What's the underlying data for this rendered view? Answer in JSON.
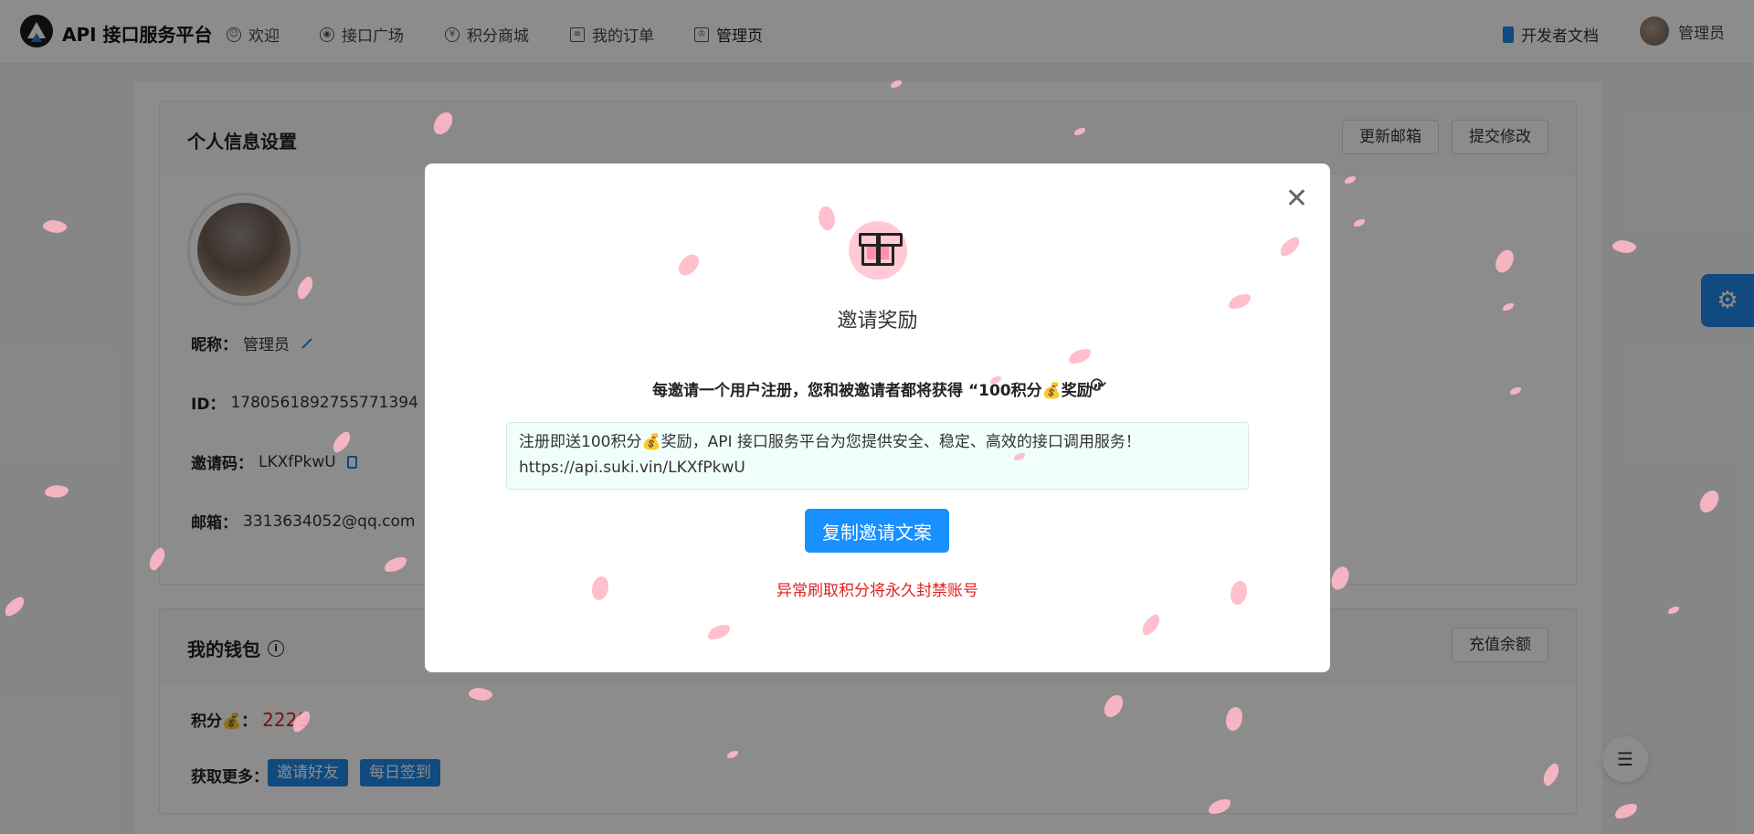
{
  "header": {
    "brand": "API 接口服务平台",
    "nav": [
      {
        "label": "欢迎",
        "icon": "smile-icon"
      },
      {
        "label": "接口广场",
        "icon": "api-icon"
      },
      {
        "label": "积分商城",
        "icon": "yen-icon"
      },
      {
        "label": "我的订单",
        "icon": "order-icon"
      },
      {
        "label": "管理页",
        "icon": "crown-icon"
      }
    ],
    "docs": "开发者文档",
    "user": "管理员"
  },
  "profile": {
    "title": "个人信息设置",
    "update_email": "更新邮箱",
    "submit": "提交修改",
    "nickname_label": "昵称：",
    "nickname": "管理员",
    "id_label": "ID：",
    "id": "1780561892755771394",
    "invite_label": "邀请码：",
    "invite_code": "LKXfPkwU",
    "email_label": "邮箱：",
    "email": "3313634052@qq.com"
  },
  "wallet": {
    "title": "我的钱包",
    "recharge": "充值余额",
    "points_label": "积分💰：",
    "points": "2229",
    "more_label": "获取更多：",
    "invite_btn": "邀请好友",
    "signin_btn": "每日签到"
  },
  "modal": {
    "title": "邀请奖励",
    "desc": "每邀请一个用户注册，您和被邀请者都将获得 “100积分💰奖励”",
    "copy_text_line1": "注册即送100积分💰奖励，API 接口服务平台为您提供安全、稳定、高效的接口调用服务！",
    "copy_text_line2": "https://api.suki.vin/LKXfPkwU",
    "copy_button": "复制邀请文案",
    "warning": "异常刷取积分将永久封禁账号"
  },
  "colors": {
    "primary": "#1890ff",
    "danger": "#e02020",
    "petal": "#ffb8c8"
  }
}
